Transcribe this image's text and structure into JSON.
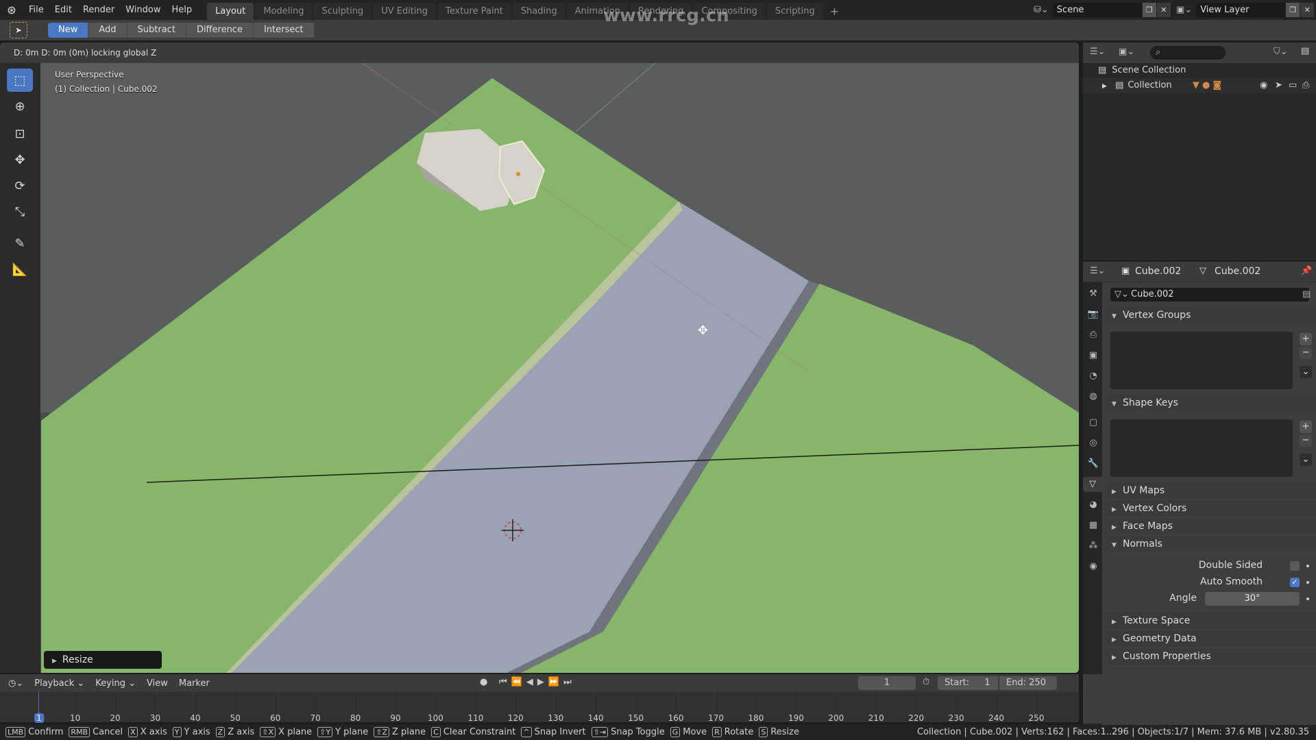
{
  "menubar": {
    "items": [
      "File",
      "Edit",
      "Render",
      "Window",
      "Help"
    ],
    "workspaces": [
      "Layout",
      "Modeling",
      "Sculpting",
      "UV Editing",
      "Texture Paint",
      "Shading",
      "Animation",
      "Rendering",
      "Compositing",
      "Scripting"
    ],
    "active_workspace": "Layout",
    "add_workspace": "+",
    "scene": "Scene",
    "view_layer": "View Layer",
    "watermark_url": "www.rrcg.cn"
  },
  "tool_header": {
    "modes": [
      "New",
      "Add",
      "Subtract",
      "Difference",
      "Intersect"
    ],
    "active_mode": "New"
  },
  "viewport": {
    "status_text": "D: 0m   D: 0m (0m) locking global Z",
    "perspective": "User Perspective",
    "object_info": "(1) Collection | Cube.002",
    "last_op_panel": "Resize",
    "colors": {
      "grass": "#86b66a",
      "road": "#9aa3b4",
      "background": "#5a5d5d",
      "curb": "#b9c49a"
    }
  },
  "outliner": {
    "search_placeholder": "",
    "scene_collection": "Scene Collection",
    "collection": "Collection"
  },
  "properties": {
    "object_name": "Cube.002",
    "mesh_name": "Cube.002",
    "datablock": "Cube.002",
    "panels": {
      "vertex_groups": "Vertex Groups",
      "shape_keys": "Shape Keys",
      "uv_maps": "UV Maps",
      "vertex_colors": "Vertex Colors",
      "face_maps": "Face Maps",
      "normals": "Normals",
      "texture_space": "Texture Space",
      "geometry_data": "Geometry Data",
      "custom_properties": "Custom Properties"
    },
    "normals": {
      "double_sided_label": "Double Sided",
      "double_sided": false,
      "auto_smooth_label": "Auto Smooth",
      "auto_smooth": true,
      "angle_label": "Angle",
      "angle": "30°"
    }
  },
  "timeline": {
    "menus": [
      "Playback",
      "Keying",
      "View",
      "Marker"
    ],
    "current_frame": "1",
    "start_label": "Start:",
    "start": "1",
    "end_label": "End:",
    "end": "250",
    "ruler": [
      "1",
      "10",
      "20",
      "30",
      "40",
      "50",
      "60",
      "70",
      "80",
      "90",
      "100",
      "110",
      "120",
      "130",
      "140",
      "150",
      "160",
      "170",
      "180",
      "190",
      "200",
      "210",
      "220",
      "230",
      "240",
      "250"
    ]
  },
  "statusbar": {
    "hints": [
      {
        "key": "LMB",
        "label": "Confirm"
      },
      {
        "key": "RMB",
        "label": "Cancel"
      },
      {
        "key": "X",
        "label": "X axis"
      },
      {
        "key": "Y",
        "label": "Y axis"
      },
      {
        "key": "Z",
        "label": "Z axis"
      },
      {
        "key": "⇧X",
        "label": "X plane"
      },
      {
        "key": "⇧Y",
        "label": "Y plane"
      },
      {
        "key": "⇧Z",
        "label": "Z plane"
      },
      {
        "key": "C",
        "label": "Clear Constraint"
      },
      {
        "key": "^",
        "label": "Snap Invert"
      },
      {
        "key": "⇧⇥",
        "label": "Snap Toggle"
      },
      {
        "key": "G",
        "label": "Move"
      },
      {
        "key": "R",
        "label": "Rotate"
      },
      {
        "key": "S",
        "label": "Resize"
      }
    ],
    "stats": "Collection | Cube.002 | Verts:162 | Faces:1..296 | Objects:1/7 | Mem: 37.6 MB | v2.80.35"
  }
}
